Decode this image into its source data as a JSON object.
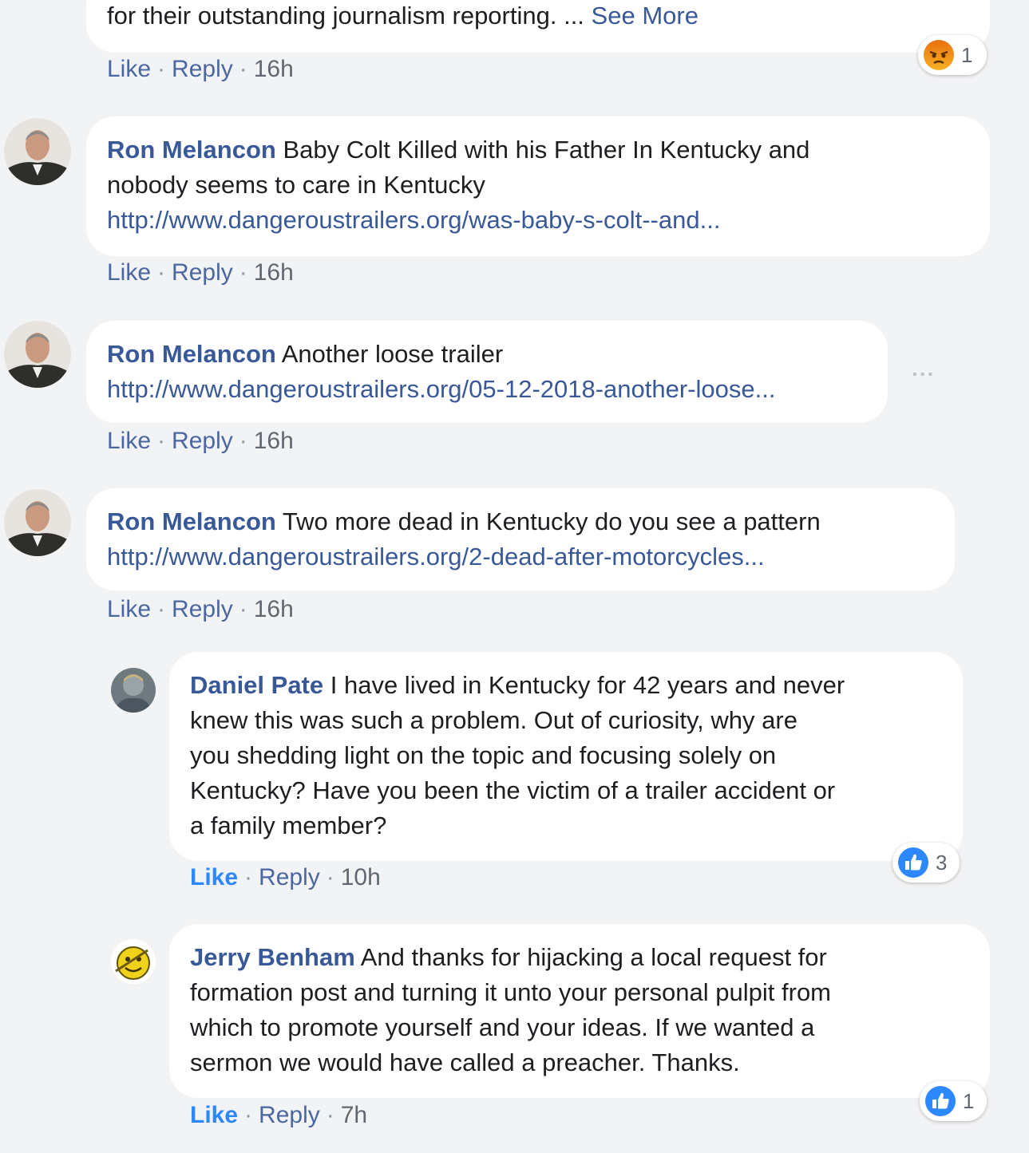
{
  "comments": [
    {
      "text": "for their outstanding journalism reporting. ...",
      "see_more": "See More",
      "actions": {
        "like": "Like",
        "reply": "Reply",
        "time": "16h"
      },
      "reaction": {
        "icon": "angry-icon",
        "count": "1"
      }
    },
    {
      "author": "Ron Melancon",
      "text_line1": "Baby Colt Killed with his Father In Kentucky and",
      "text_line2": "nobody seems to care in Kentucky",
      "link": "http://www.dangeroustrailers.org/was-baby-s-colt--and...",
      "actions": {
        "like": "Like",
        "reply": "Reply",
        "time": "16h"
      }
    },
    {
      "author": "Ron Melancon",
      "text": "Another loose trailer",
      "link": "http://www.dangeroustrailers.org/05-12-2018-another-loose...",
      "actions": {
        "like": "Like",
        "reply": "Reply",
        "time": "16h"
      },
      "more_options": "..."
    },
    {
      "author": "Ron Melancon",
      "text": "Two more dead in Kentucky do you see a pattern",
      "link": "http://www.dangeroustrailers.org/2-dead-after-motorcycles...",
      "actions": {
        "like": "Like",
        "reply": "Reply",
        "time": "16h"
      }
    }
  ],
  "replies": [
    {
      "author": "Daniel Pate",
      "lines": [
        "I have lived in Kentucky for 42 years and never",
        "knew this was such a problem. Out of curiosity, why are",
        "you shedding light on the topic and focusing solely on",
        "Kentucky? Have you been the victim of a trailer accident or",
        "a family member?"
      ],
      "actions": {
        "like": "Like",
        "reply": "Reply",
        "time": "10h"
      },
      "reaction": {
        "icon": "like-icon",
        "count": "3"
      }
    },
    {
      "author": "Jerry Benham",
      "lines": [
        "And thanks for hijacking a local request for",
        "formation post and turning it unto your personal pulpit from",
        "which to promote yourself and your ideas. If we wanted a",
        "sermon we would have called a preacher. Thanks."
      ],
      "actions": {
        "like": "Like",
        "reply": "Reply",
        "time": "7h"
      },
      "reaction": {
        "icon": "like-icon",
        "count": "1"
      }
    }
  ],
  "colors": {
    "author": "#385898",
    "like_active": "#2d88ff",
    "background": "#f2f3f5",
    "angry": "#e9710f"
  }
}
